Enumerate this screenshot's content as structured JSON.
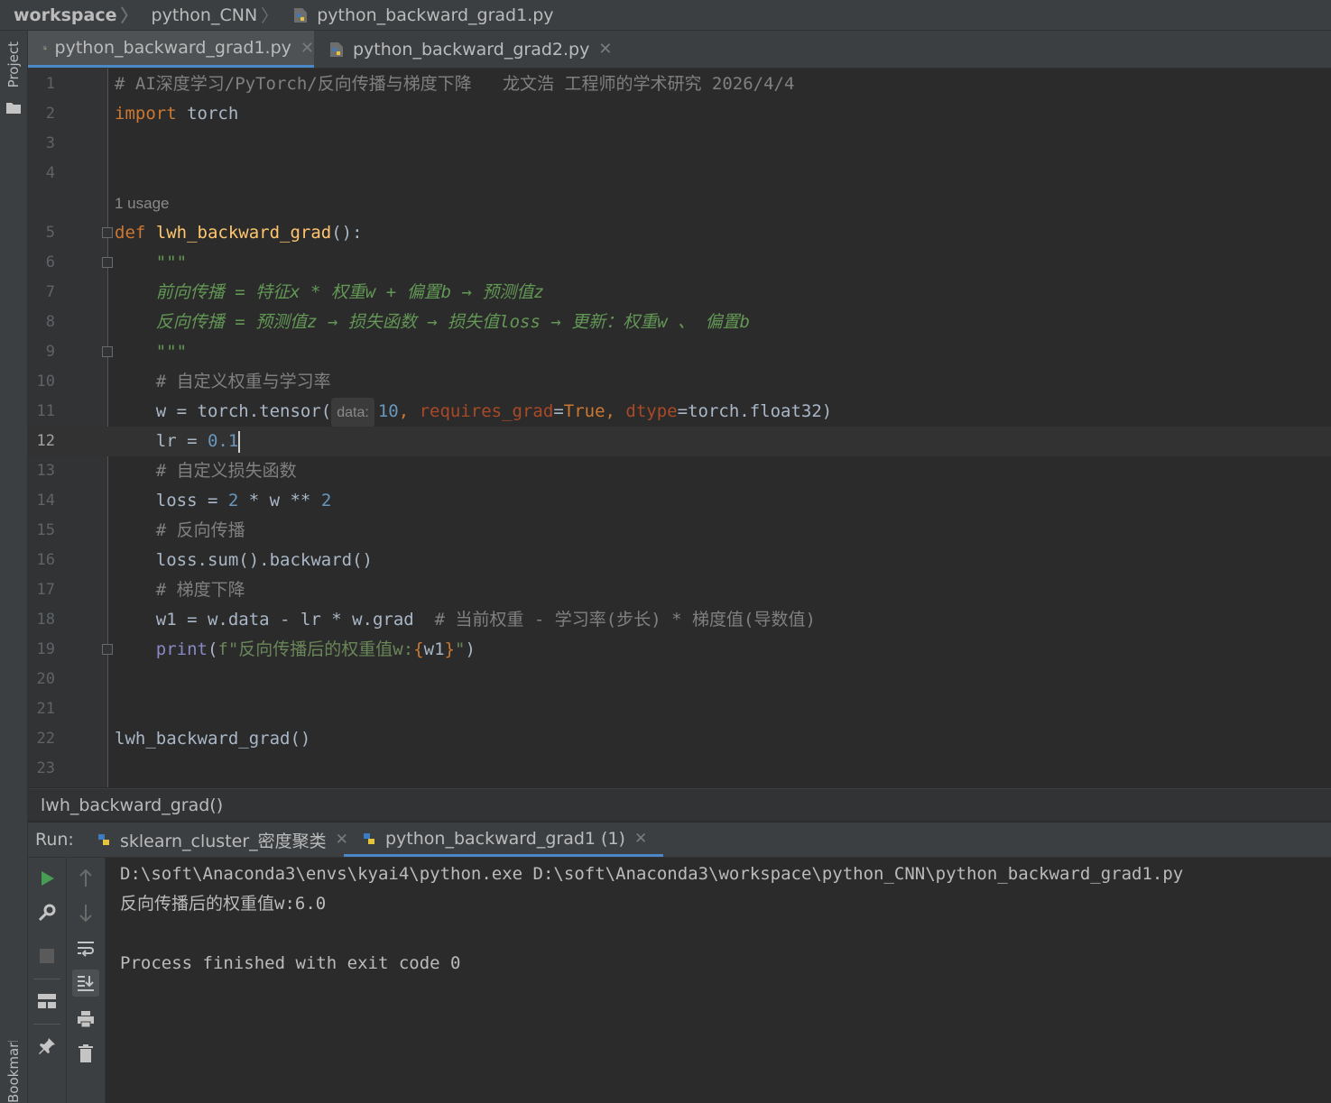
{
  "breadcrumb": [
    "workspace",
    "python_CNN",
    "python_backward_grad1.py"
  ],
  "left_strip": {
    "project_label": "Project",
    "bookmarks_label": "Bookmarks"
  },
  "tabs": [
    {
      "label": "python_backward_grad1.py",
      "active": true
    },
    {
      "label": "python_backward_grad2.py",
      "active": false
    }
  ],
  "editor": {
    "current_line": 12,
    "usage_hint": "1 usage",
    "param_hint": "data:",
    "line_numbers": [
      "1",
      "2",
      "3",
      "4",
      "5",
      "6",
      "7",
      "8",
      "9",
      "10",
      "11",
      "12",
      "13",
      "14",
      "15",
      "16",
      "17",
      "18",
      "19",
      "20",
      "21",
      "22",
      "23"
    ],
    "lines": {
      "l1": "# AI深度学习/PyTorch/反向传播与梯度下降   龙文浩 工程师的学术研究 2026/4/4",
      "l2_kw": "import",
      "l2_mod": " torch",
      "l5_kw": "def ",
      "l5_fn": "lwh_backward_grad",
      "l5_rest": "():",
      "l6": "    \"\"\"",
      "l7": "    前向传播 = 特征x * 权重w + 偏置b → 预测值z",
      "l8": "    反向传播 = 预测值z → 损失函数 → 损失值loss → 更新：权重w 、 偏置b",
      "l9": "    \"\"\"",
      "l10": "    # 自定义权重与学习率",
      "l11_a": "    w = torch.tensor(",
      "l11_num": "10",
      "l11_c1": ", ",
      "l11_p1": "requires_grad",
      "l11_eq1": "=",
      "l11_true": "True",
      "l11_c2": ", ",
      "l11_p2": "dtype",
      "l11_rest": "=torch.float32)",
      "l12_a": "    lr = ",
      "l12_num": "0.1",
      "l13": "    # 自定义损失函数",
      "l14_a": "    loss = ",
      "l14_n1": "2",
      "l14_b": " * w ** ",
      "l14_n2": "2",
      "l15": "    # 反向传播",
      "l16": "    loss.sum().backward()",
      "l17": "    # 梯度下降",
      "l18_a": "    w1 = w.data - lr * w.grad  ",
      "l18_cm": "# 当前权重 - 学习率(步长) * 梯度值(导数值)",
      "l19_a": "    ",
      "l19_fn": "print",
      "l19_p": "(",
      "l19_f": "f\"反向传播后的权重值w:",
      "l19_lb": "{",
      "l19_var": "w1",
      "l19_rb": "}",
      "l19_end": "\"",
      "l19_close": ")",
      "l22": "lwh_backward_grad()"
    }
  },
  "structure_bar": "lwh_backward_grad()",
  "run": {
    "label": "Run:",
    "tabs": [
      {
        "label": "sklearn_cluster_密度聚类",
        "active": false
      },
      {
        "label": "python_backward_grad1 (1)",
        "active": true
      }
    ],
    "console": [
      "D:\\soft\\Anaconda3\\envs\\kyai4\\python.exe D:\\soft\\Anaconda3\\workspace\\python_CNN\\python_backward_grad1.py",
      "反向传播后的权重值w:6.0",
      "",
      "Process finished with exit code 0"
    ]
  },
  "colors": {
    "accent": "#4a88c7",
    "run_green": "#499c54",
    "keyword": "#cc7832",
    "function": "#ffc66d",
    "docstring": "#629755",
    "number": "#6897bb"
  }
}
